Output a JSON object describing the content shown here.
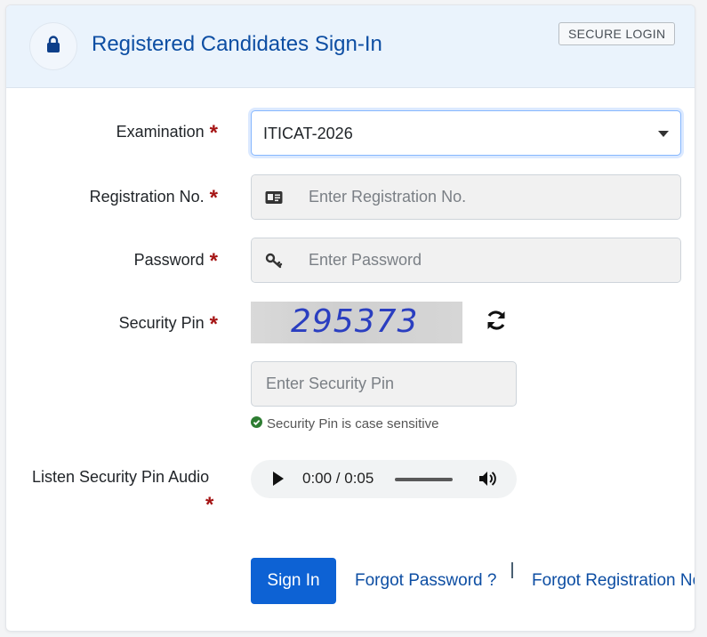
{
  "header": {
    "title": "Registered Candidates Sign-In",
    "badge": "SECURE LOGIN",
    "lock_icon": "lock-icon"
  },
  "form": {
    "required_marker": "*",
    "examination": {
      "label": "Examination",
      "selected": "ITICAT-2026"
    },
    "registration": {
      "label": "Registration No.",
      "placeholder": "Enter Registration No.",
      "icon": "id-card-icon"
    },
    "password": {
      "label": "Password",
      "placeholder": "Enter Password",
      "icon": "key-icon"
    },
    "security_pin": {
      "label": "Security Pin",
      "captcha_text": "295373",
      "placeholder": "Enter Security Pin",
      "hint": "Security Pin is case sensitive",
      "refresh_icon": "refresh-icon"
    },
    "audio": {
      "label": "Listen Security Pin Audio",
      "time": "0:00 / 0:05"
    }
  },
  "actions": {
    "sign_in": "Sign In",
    "forgot_password": "Forgot Password ?",
    "forgot_registration": "Forgot Registration No."
  },
  "colors": {
    "accent": "#0d62d4",
    "title": "#0d4ea3",
    "required": "#a51414",
    "hint_check": "#2e7d32"
  }
}
